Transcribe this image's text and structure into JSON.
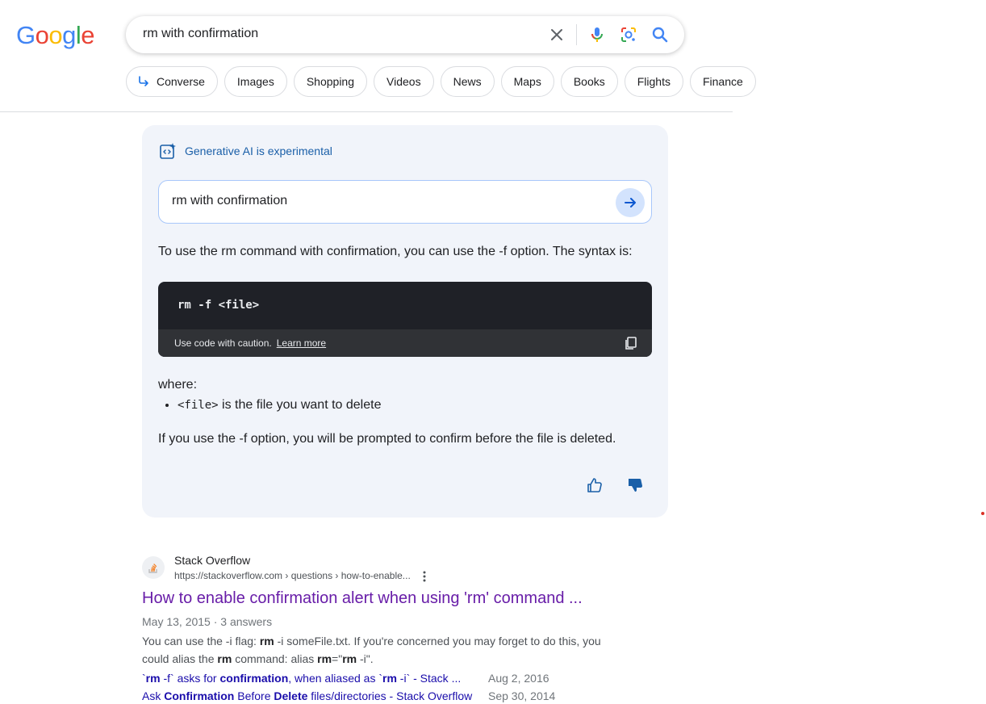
{
  "logo": {
    "letters": [
      "G",
      "o",
      "o",
      "g",
      "l",
      "e"
    ],
    "colors": [
      "#4285F4",
      "#EA4335",
      "#FBBC05",
      "#4285F4",
      "#34A853",
      "#EA4335"
    ]
  },
  "search": {
    "query": "rm with confirmation"
  },
  "chips": [
    {
      "label": "Converse",
      "icon": "converse-arrow-icon"
    },
    {
      "label": "Images"
    },
    {
      "label": "Shopping"
    },
    {
      "label": "Videos"
    },
    {
      "label": "News"
    },
    {
      "label": "Maps"
    },
    {
      "label": "Books"
    },
    {
      "label": "Flights"
    },
    {
      "label": "Finance"
    }
  ],
  "ai": {
    "badge": "Generative AI is experimental",
    "followup_query": "rm with confirmation",
    "intro": "To use the rm command with confirmation, you can use the -f option. The syntax is:",
    "code": "rm -f <file>",
    "code_caution": "Use code with caution.",
    "learn_more": "Learn more",
    "where": "where:",
    "bullet_code": "<file>",
    "bullet_text": " is the file you want to delete",
    "note": "If you use the -f option, you will be prompted to confirm before the file is deleted."
  },
  "result": {
    "site": "Stack Overflow",
    "url": "https://stackoverflow.com › questions › how-to-enable...",
    "title": "How to enable confirmation alert when using 'rm' command ...",
    "meta": "May 13, 2015 · 3 answers",
    "sitelinks": [
      {
        "date": "Aug 2, 2016"
      },
      {
        "date": "Sep 30, 2014"
      }
    ]
  },
  "colors": {
    "visited_link": "#681da8",
    "link": "#1a0dab",
    "ai_panel": "#f1f4fa",
    "code_bg": "#1f2127"
  }
}
